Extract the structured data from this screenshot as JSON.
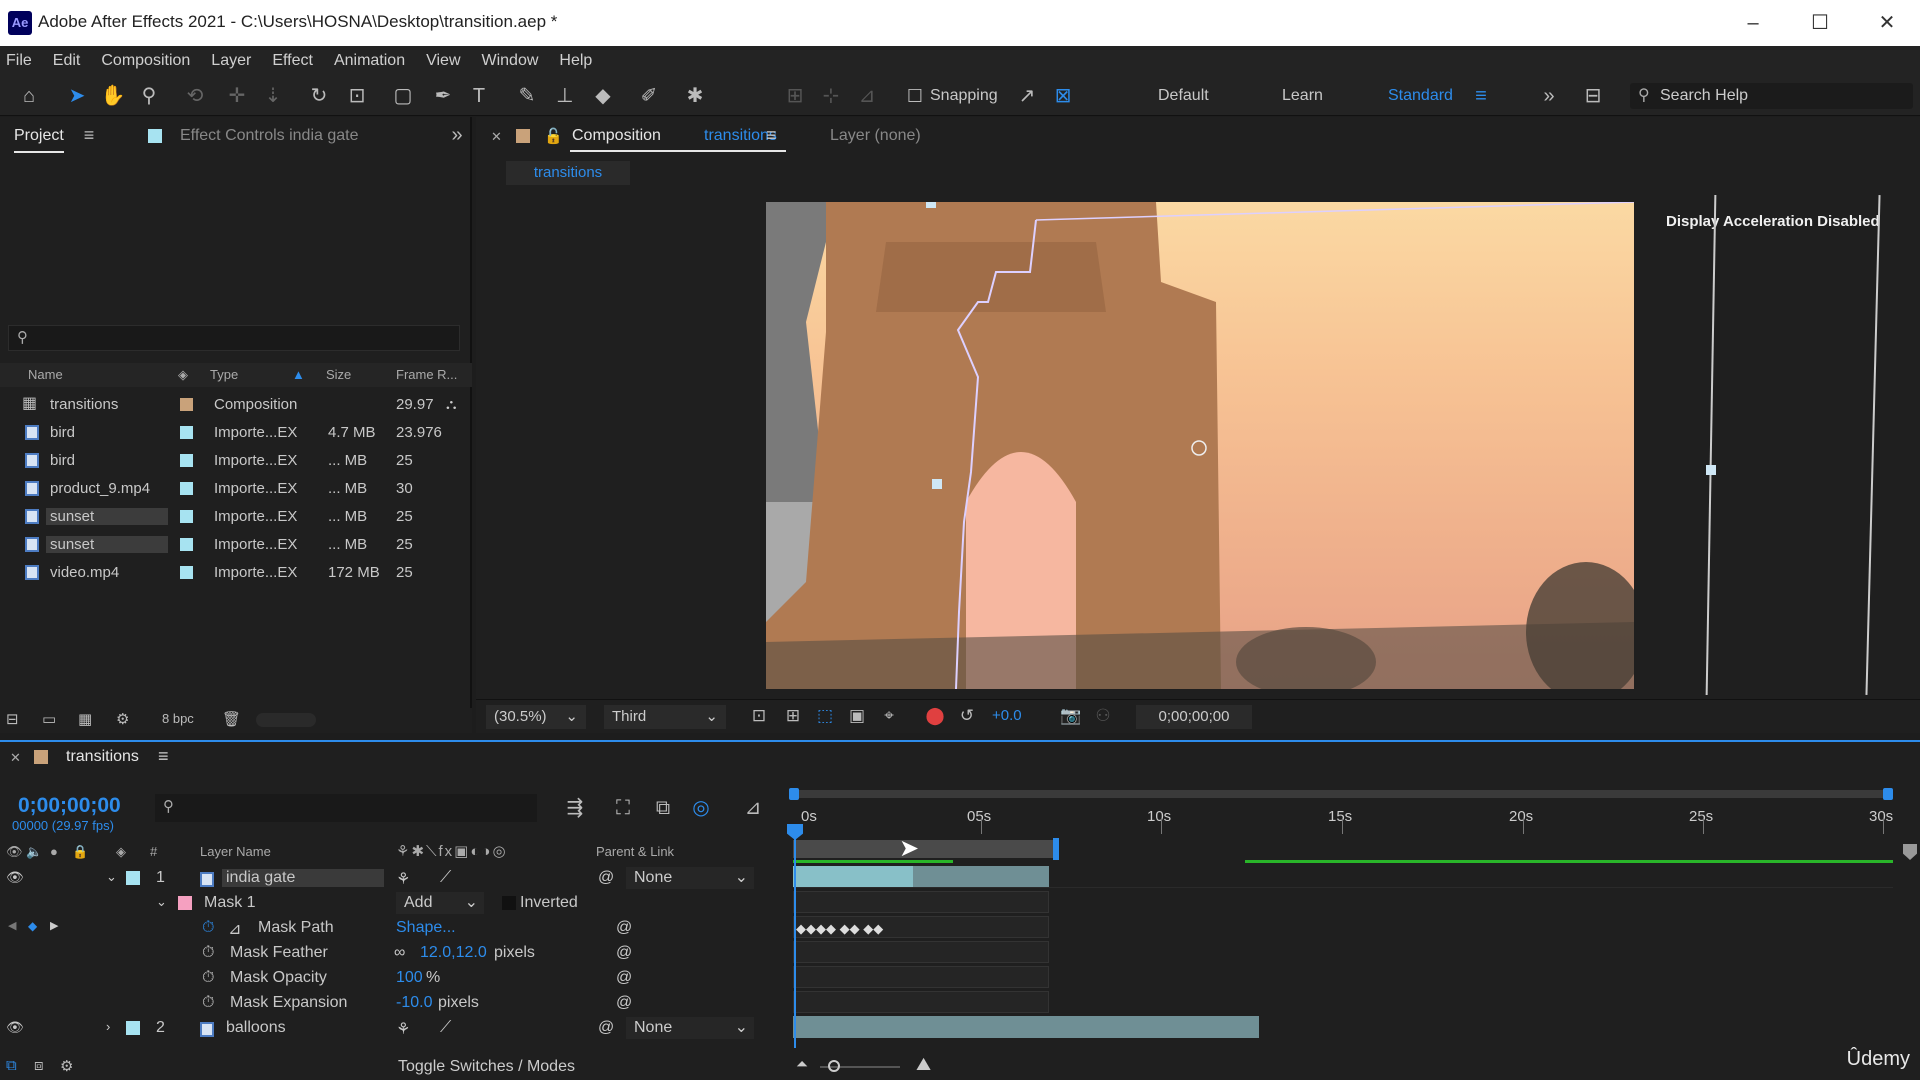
{
  "window": {
    "title": "Adobe After Effects 2021 - C:\\Users\\HOSNA\\Desktop\\transition.aep *",
    "logo": "Ae",
    "minimize": "–",
    "maximize": "☐",
    "close": "✕"
  },
  "menu": [
    "File",
    "Edit",
    "Composition",
    "Layer",
    "Effect",
    "Animation",
    "View",
    "Window",
    "Help"
  ],
  "toolbar": {
    "snapping_label": "Snapping",
    "workspaces": [
      "Default",
      "Learn",
      "Standard"
    ],
    "active_workspace": "Standard",
    "search_placeholder": "Search Help"
  },
  "project_panel": {
    "tab_project": "Project",
    "tab_effect_controls": "Effect Controls india gate",
    "columns": [
      "Name",
      "Type",
      "Size",
      "Frame R..."
    ],
    "items": [
      {
        "name": "transitions",
        "type": "Composition",
        "size": "",
        "fps": "29.97",
        "color": "#c9a27a",
        "kind": "comp"
      },
      {
        "name": "bird",
        "type": "Importe...EX",
        "size": "4.7 MB",
        "fps": "23.976",
        "color": "#a7e3f1",
        "kind": "file"
      },
      {
        "name": "bird",
        "type": "Importe...EX",
        "size": "... MB",
        "fps": "25",
        "color": "#a7e3f1",
        "kind": "file"
      },
      {
        "name": "product_9.mp4",
        "type": "Importe...EX",
        "size": "... MB",
        "fps": "30",
        "color": "#a7e3f1",
        "kind": "file"
      },
      {
        "name": "sunset",
        "type": "Importe...EX",
        "size": "... MB",
        "fps": "25",
        "color": "#a7e3f1",
        "kind": "file"
      },
      {
        "name": "sunset",
        "type": "Importe...EX",
        "size": "... MB",
        "fps": "25",
        "color": "#a7e3f1",
        "kind": "file"
      },
      {
        "name": "video.mp4",
        "type": "Importe...EX",
        "size": "172 MB",
        "fps": "25",
        "color": "#a7e3f1",
        "kind": "file"
      }
    ],
    "bpc": "8 bpc"
  },
  "comp_panel": {
    "tab_prefix": "Composition",
    "tab_name": "transitions",
    "layer_tab": "Layer (none)",
    "subtab": "transitions",
    "display_note": "Display Acceleration Disabled",
    "zoom": "(30.5%)",
    "resolution": "Third",
    "exposure": "+0.0",
    "timecode": "0;00;00;00"
  },
  "timeline": {
    "tab": "transitions",
    "timecode": "0;00;00;00",
    "fps_readout": "00000 (29.97 fps)",
    "columns": {
      "layer_name": "Layer Name",
      "parent": "Parent & Link"
    },
    "ruler": [
      "0s",
      "05s",
      "10s",
      "15s",
      "20s",
      "25s",
      "30s"
    ],
    "layers": [
      {
        "index": "1",
        "name": "india gate",
        "parent": "None"
      },
      {
        "index": "2",
        "name": "balloons",
        "parent": "None"
      }
    ],
    "mask": {
      "name": "Mask 1",
      "mode": "Add",
      "inverted_label": "Inverted",
      "path_label": "Mask Path",
      "path_value": "Shape...",
      "feather_label": "Mask Feather",
      "feather_value": "12.0,12.0",
      "feather_unit": "pixels",
      "opacity_label": "Mask Opacity",
      "opacity_value": "100",
      "opacity_unit": "%",
      "expansion_label": "Mask Expansion",
      "expansion_value": "-10.0",
      "expansion_unit": "pixels"
    },
    "toggle_label": "Toggle Switches / Modes"
  },
  "watermark": "Ûdemy"
}
